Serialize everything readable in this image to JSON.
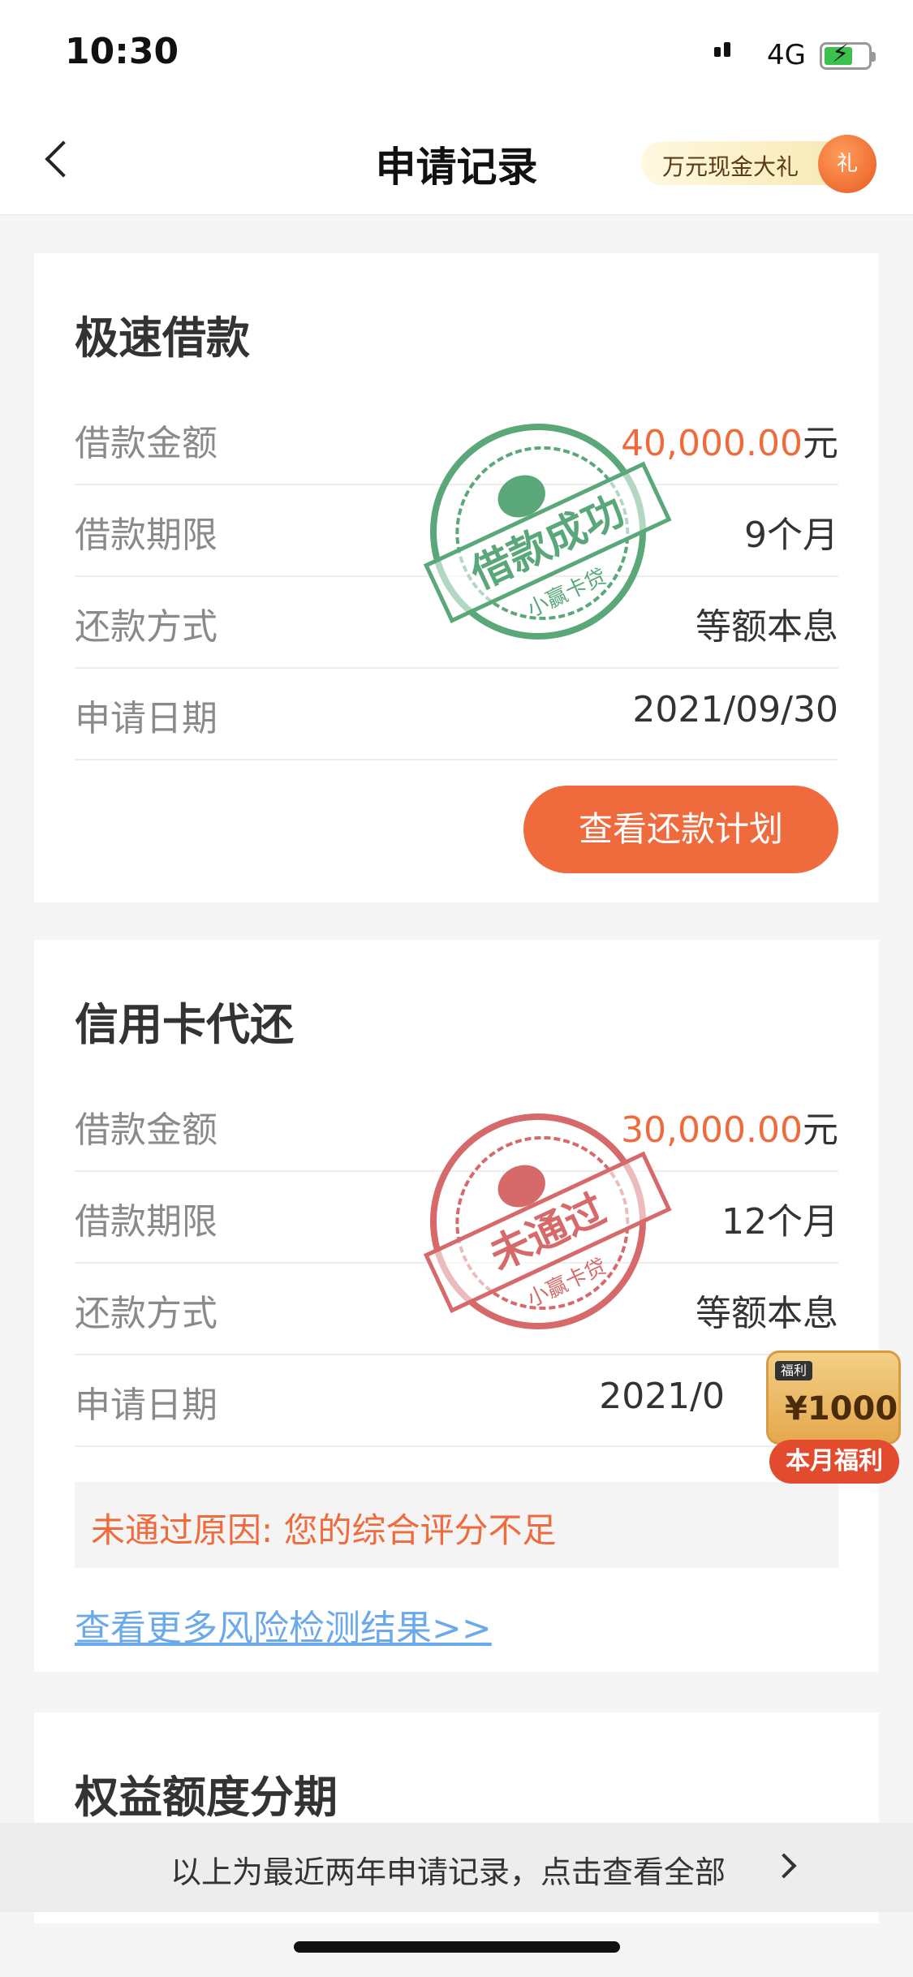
{
  "status": {
    "time": "10:30",
    "network": "4G"
  },
  "nav": {
    "title": "申请记录",
    "promo_text": "万元现金大礼",
    "promo_bag": "礼"
  },
  "cards": [
    {
      "title": "极速借款",
      "rows": [
        {
          "label": "借款金额",
          "amount": "40,000.00",
          "unit": "元"
        },
        {
          "label": "借款期限",
          "value": "9个月"
        },
        {
          "label": "还款方式",
          "value": "等额本息"
        },
        {
          "label": "申请日期",
          "value": "2021/09/30"
        }
      ],
      "stamp": {
        "main": "借款成功",
        "sub": "小赢卡贷",
        "color": "#5aa77a"
      },
      "button_label": "查看还款计划"
    },
    {
      "title": "信用卡代还",
      "rows": [
        {
          "label": "借款金额",
          "amount": "30,000.00",
          "unit": "元"
        },
        {
          "label": "借款期限",
          "value": "12个月"
        },
        {
          "label": "还款方式",
          "value": "等额本息"
        },
        {
          "label": "申请日期",
          "value": "2021/0"
        }
      ],
      "stamp": {
        "main": "未通过",
        "sub": "小赢卡贷",
        "color": "#d66a6a"
      },
      "reason": "未通过原因: 您的综合评分不足",
      "risk_link": "查看更多风险检测结果>>"
    },
    {
      "title": "权益额度分期"
    }
  ],
  "welfare": {
    "tag": "福利",
    "amount": "¥1000",
    "label": "本月福利"
  },
  "footer": {
    "text": "以上为最近两年申请记录，点击查看全部"
  },
  "colors": {
    "accent": "#ef6b3d",
    "link": "#6aa9ea",
    "success_stamp": "#5aa77a",
    "fail_stamp": "#d66a6a"
  }
}
